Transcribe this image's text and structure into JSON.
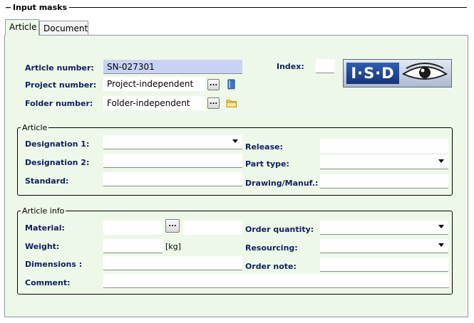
{
  "section": {
    "title": "Input masks",
    "collapse_glyph": "−"
  },
  "tabs": [
    {
      "label": "Article",
      "active": true
    },
    {
      "label": "Document",
      "active": false
    }
  ],
  "header_fields": {
    "article_number": {
      "label": "Article number:",
      "value": "SN-027301"
    },
    "project_number": {
      "label": "Project number:",
      "value": "Project-independent",
      "button": "...",
      "icon": "book-icon"
    },
    "folder_number": {
      "label": "Folder number:",
      "value": "Folder-independent",
      "button": "...",
      "icon": "folder-icon"
    },
    "index": {
      "label": "Index:",
      "value": ""
    }
  },
  "logo": {
    "text": "I·S·D",
    "icon": "eye-logo-icon"
  },
  "article_group": {
    "title": "Article",
    "designation1": {
      "label": "Designation 1:",
      "value": ""
    },
    "designation2": {
      "label": "Designation 2:",
      "value": ""
    },
    "standard": {
      "label": "Standard:",
      "value": ""
    },
    "release": {
      "label": "Release:",
      "value": ""
    },
    "part_type": {
      "label": "Part type:",
      "value": ""
    },
    "drawing_manuf": {
      "label": "Drawing/Manuf.:",
      "value": ""
    }
  },
  "info_group": {
    "title": "Article info",
    "material": {
      "label": "Material:",
      "value": "",
      "value2": "",
      "button": "..."
    },
    "weight": {
      "label": "Weight:",
      "value": "",
      "unit": "[kg]"
    },
    "dimensions": {
      "label": "Dimensions :",
      "value": ""
    },
    "comment": {
      "label": "Comment:",
      "value": ""
    },
    "order_quantity": {
      "label": "Order quantity:",
      "value": ""
    },
    "resourcing": {
      "label": "Resourcing:",
      "value": ""
    },
    "order_note": {
      "label": "Order note:",
      "value": ""
    }
  },
  "colors": {
    "panel_bg": "#eef8e8",
    "label_color": "#102060",
    "highlight_field": "#c8d2f5"
  }
}
